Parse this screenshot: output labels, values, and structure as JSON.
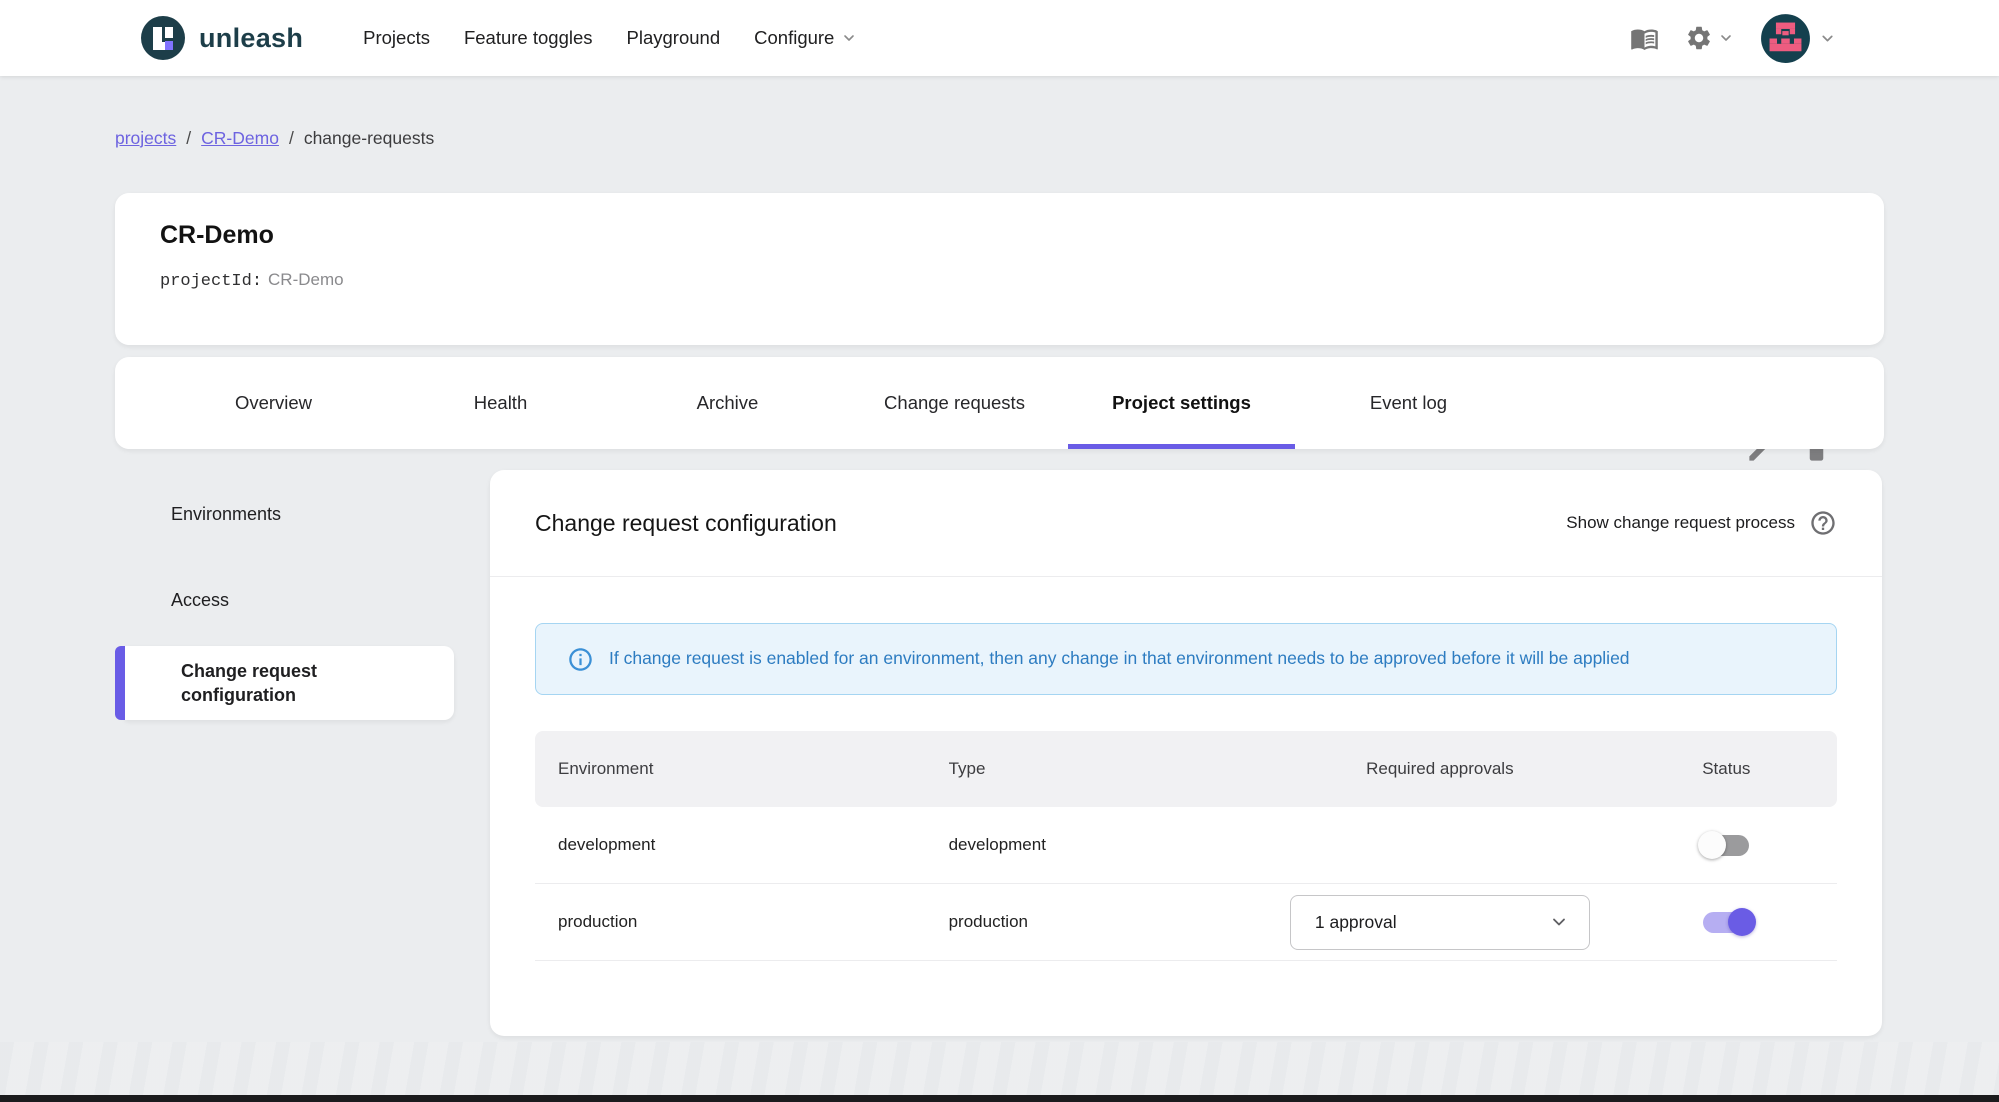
{
  "colors": {
    "accent": "#695ce6",
    "brand_teal": "#1d3e49",
    "alert_bg": "#e9f4fc",
    "alert_border": "#a5d5f2",
    "alert_text": "#2d7cc1",
    "switch_on": "#6a5ce5",
    "avatar_bg": "#14404e",
    "avatar_pink": "#ee5c80"
  },
  "topnav": {
    "brand": "unleash",
    "items": [
      {
        "label": "Projects"
      },
      {
        "label": "Feature toggles"
      },
      {
        "label": "Playground"
      },
      {
        "label": "Configure",
        "has_dropdown": true
      }
    ],
    "icons": [
      {
        "name": "documentation-book"
      },
      {
        "name": "settings-gear",
        "has_dropdown": true
      },
      {
        "name": "user-avatar",
        "has_dropdown": true
      }
    ]
  },
  "breadcrumb": {
    "items": [
      {
        "label": "projects",
        "link": true
      },
      {
        "label": "CR-Demo",
        "link": true
      },
      {
        "label": "change-requests",
        "link": false
      }
    ],
    "separator": "/"
  },
  "project_header": {
    "title": "CR-Demo",
    "project_id_label": "projectId:",
    "project_id_value": "CR-Demo",
    "actions": [
      "edit",
      "delete"
    ]
  },
  "tabs": [
    {
      "label": "Overview",
      "active": false
    },
    {
      "label": "Health",
      "active": false
    },
    {
      "label": "Archive",
      "active": false
    },
    {
      "label": "Change requests",
      "active": false
    },
    {
      "label": "Project settings",
      "active": true
    },
    {
      "label": "Event log",
      "active": false
    }
  ],
  "sidebar": {
    "items": [
      {
        "label": "Environments",
        "active": false
      },
      {
        "label": "Access",
        "active": false
      },
      {
        "label": "Change request configuration",
        "active": true
      }
    ]
  },
  "panel": {
    "title": "Change request configuration",
    "help_link": "Show change request process",
    "alert": "If change request is enabled for an environment, then any change in that environment needs to be approved before it will be applied",
    "table": {
      "columns": [
        "Environment",
        "Type",
        "Required approvals",
        "Status"
      ],
      "rows": [
        {
          "environment": "development",
          "type": "development",
          "required_approvals": null,
          "enabled": false
        },
        {
          "environment": "production",
          "type": "production",
          "required_approvals": "1 approval",
          "enabled": true
        }
      ]
    }
  }
}
